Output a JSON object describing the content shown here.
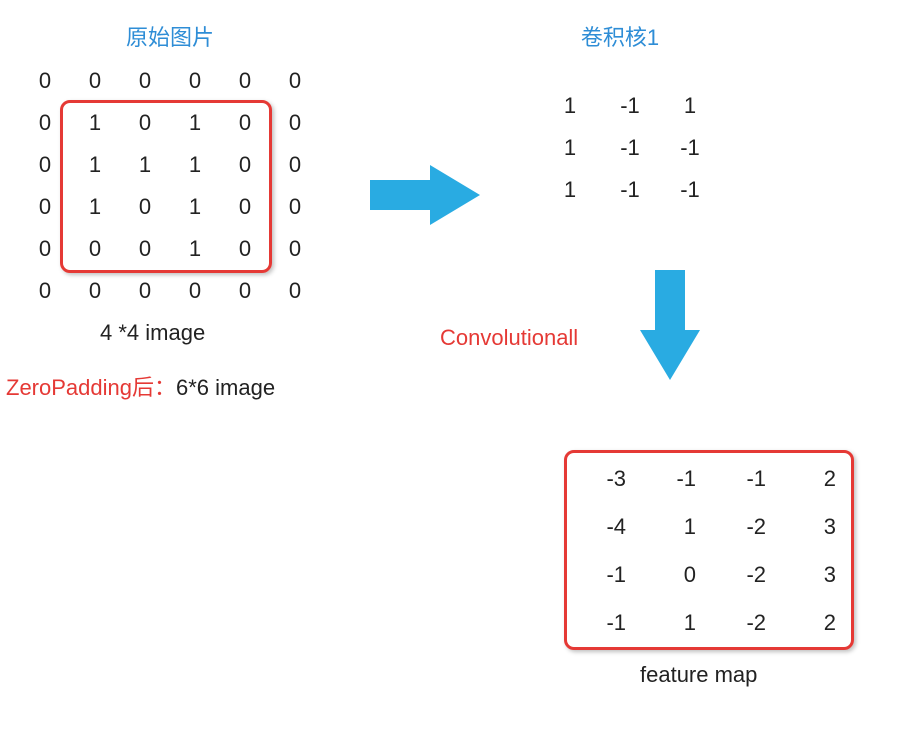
{
  "titles": {
    "left": "原始图片",
    "right": "卷积核1"
  },
  "padded_matrix": [
    [
      0,
      0,
      0,
      0,
      0,
      0
    ],
    [
      0,
      1,
      0,
      1,
      0,
      0
    ],
    [
      0,
      1,
      1,
      1,
      0,
      0
    ],
    [
      0,
      1,
      0,
      1,
      0,
      0
    ],
    [
      0,
      0,
      0,
      1,
      0,
      0
    ],
    [
      0,
      0,
      0,
      0,
      0,
      0
    ]
  ],
  "kernel": [
    [
      1,
      -1,
      1
    ],
    [
      1,
      -1,
      -1
    ],
    [
      1,
      -1,
      -1
    ]
  ],
  "feature_map": [
    [
      -3,
      -1,
      -1,
      2
    ],
    [
      -4,
      1,
      -2,
      3
    ],
    [
      -1,
      0,
      -2,
      3
    ],
    [
      -1,
      1,
      -2,
      2
    ]
  ],
  "labels": {
    "image_size": "4 *4 image",
    "zeropad_prefix": "ZeroPadding后：",
    "zeropad_suffix": "6*6 image",
    "convolutional": "Convolutionall",
    "feature_map": "feature map"
  },
  "chart_data": {
    "type": "table",
    "description": "Convolution diagram: original 4x4 image zero-padded to 6x6, convolved with 3x3 kernel to produce 4x4 feature map",
    "original_image_4x4": [
      [
        1,
        0,
        1,
        0
      ],
      [
        1,
        1,
        1,
        0
      ],
      [
        1,
        0,
        1,
        0
      ],
      [
        0,
        0,
        1,
        0
      ]
    ],
    "zero_padded_6x6": [
      [
        0,
        0,
        0,
        0,
        0,
        0
      ],
      [
        0,
        1,
        0,
        1,
        0,
        0
      ],
      [
        0,
        1,
        1,
        1,
        0,
        0
      ],
      [
        0,
        1,
        0,
        1,
        0,
        0
      ],
      [
        0,
        0,
        0,
        1,
        0,
        0
      ],
      [
        0,
        0,
        0,
        0,
        0,
        0
      ]
    ],
    "kernel_3x3": [
      [
        1,
        -1,
        1
      ],
      [
        1,
        -1,
        -1
      ],
      [
        1,
        -1,
        -1
      ]
    ],
    "feature_map_4x4": [
      [
        -3,
        -1,
        -1,
        2
      ],
      [
        -4,
        1,
        -2,
        3
      ],
      [
        -1,
        0,
        -2,
        3
      ],
      [
        -1,
        1,
        -2,
        2
      ]
    ]
  }
}
